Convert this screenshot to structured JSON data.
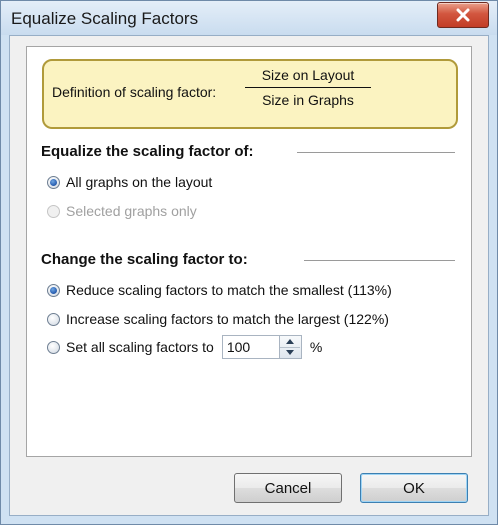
{
  "window": {
    "title": "Equalize Scaling Factors",
    "close_icon": "close-x-icon"
  },
  "definition": {
    "label": "Definition of scaling factor:",
    "numerator": "Size on Layout",
    "denominator": "Size in Graphs"
  },
  "equalize": {
    "heading": "Equalize the scaling factor of:",
    "options": [
      {
        "label": "All graphs on the layout",
        "checked": true,
        "enabled": true
      },
      {
        "label": "Selected graphs only",
        "checked": false,
        "enabled": false
      }
    ]
  },
  "change": {
    "heading": "Change the scaling  factor to:",
    "options": [
      {
        "label": "Reduce scaling factors to match the smallest (113%)",
        "checked": true
      },
      {
        "label": "Increase scaling factors to match the largest (122%)",
        "checked": false
      },
      {
        "label": "Set all scaling factors to",
        "checked": false
      }
    ],
    "set_value": "100",
    "percent_sign": "%"
  },
  "buttons": {
    "cancel": "Cancel",
    "ok": "OK"
  },
  "colors": {
    "definition_bg": "#fbf3c1",
    "definition_border": "#b09a3a",
    "close_button": "#c23d27",
    "frame": "#cfe1f2"
  }
}
